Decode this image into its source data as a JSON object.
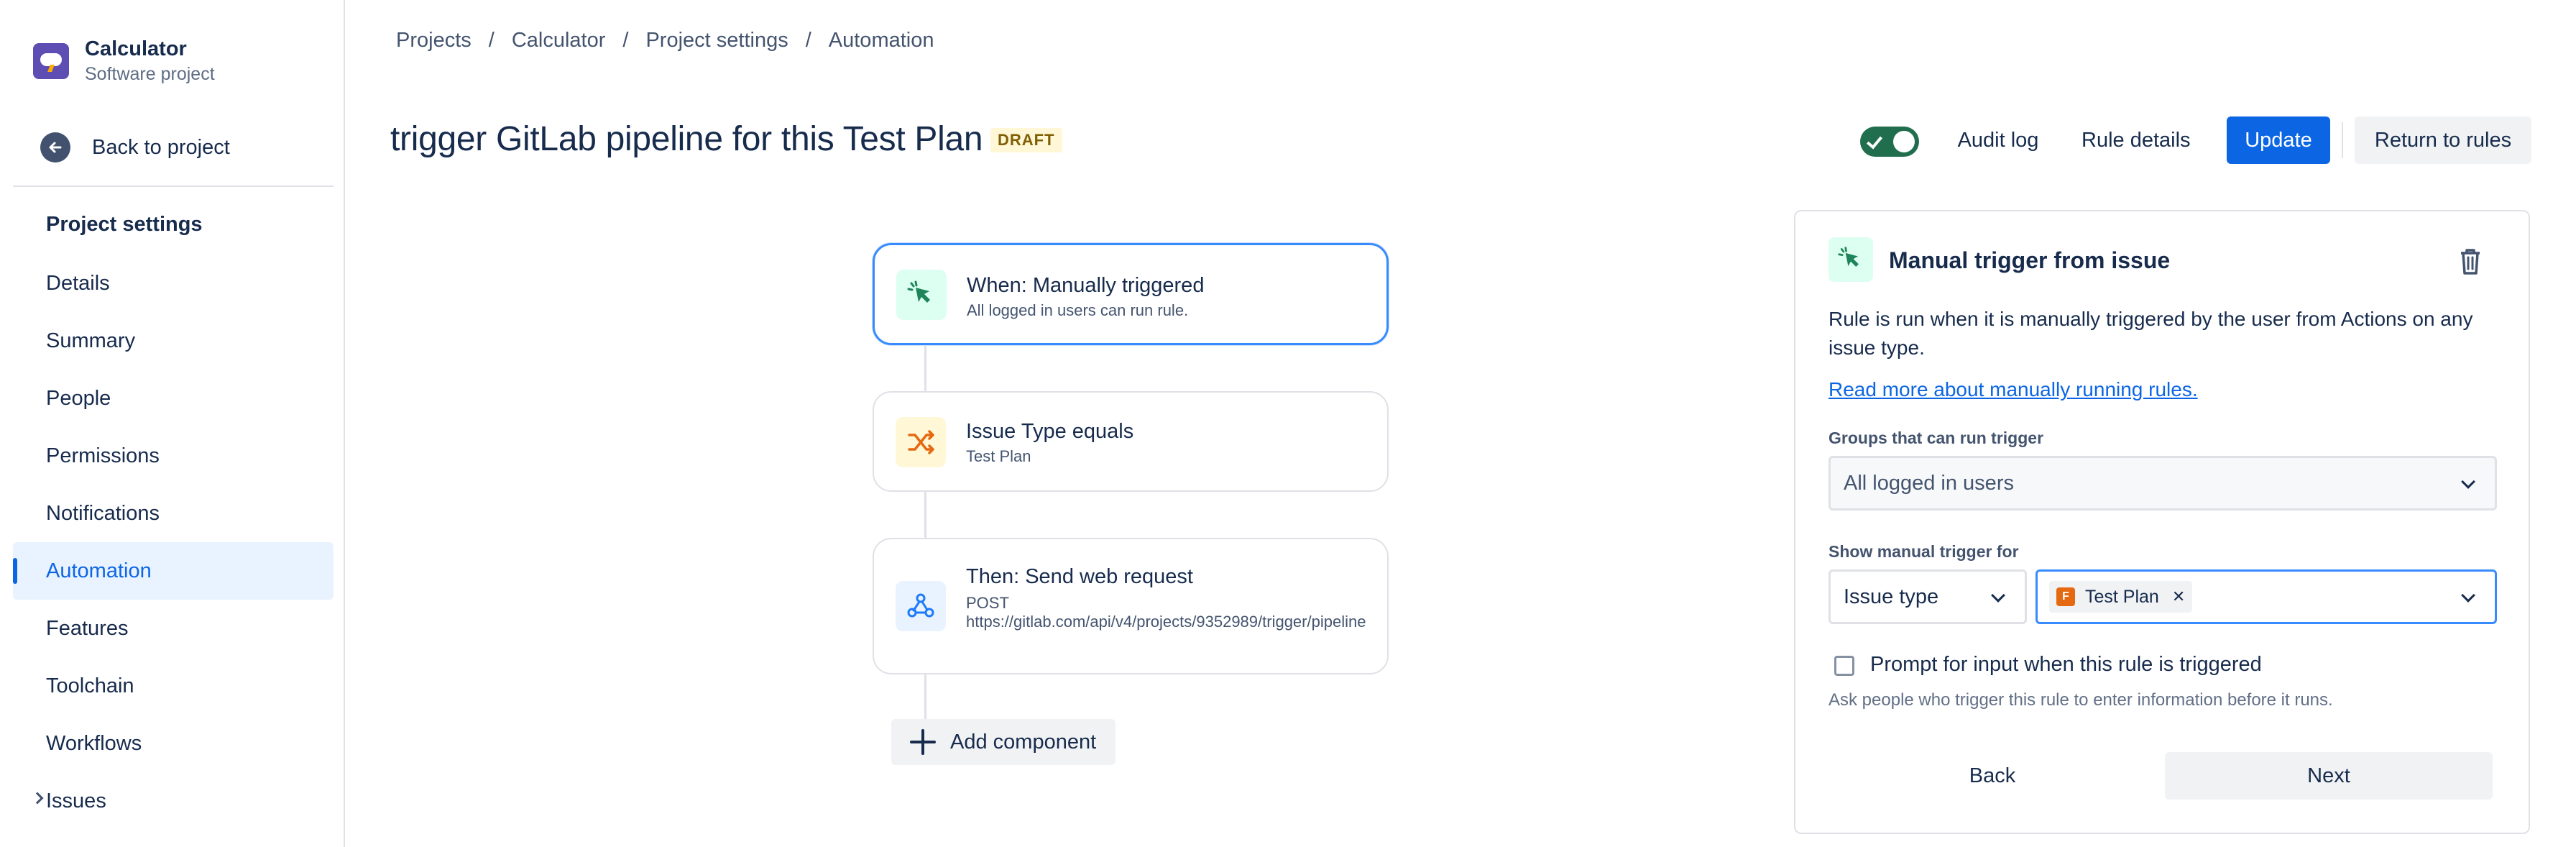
{
  "project": {
    "name": "Calculator",
    "type": "Software project"
  },
  "sidebar": {
    "back_label": "Back to project",
    "heading": "Project settings",
    "items": [
      {
        "label": "Details"
      },
      {
        "label": "Summary"
      },
      {
        "label": "People"
      },
      {
        "label": "Permissions"
      },
      {
        "label": "Notifications"
      },
      {
        "label": "Automation",
        "active": true
      },
      {
        "label": "Features"
      },
      {
        "label": "Toolchain"
      },
      {
        "label": "Workflows"
      },
      {
        "label": "Issues"
      }
    ]
  },
  "breadcrumb": [
    "Projects",
    "Calculator",
    "Project settings",
    "Automation"
  ],
  "breadcrumb_sep": "/",
  "header": {
    "title": "trigger GitLab pipeline for this Test Plan",
    "status": "DRAFT",
    "toggle_enabled": true,
    "audit_log": "Audit log",
    "rule_details": "Rule details",
    "update": "Update",
    "return": "Return to rules"
  },
  "flow": {
    "trigger": {
      "title": "When: Manually triggered",
      "subtitle": "All logged in users can run rule.",
      "icon": "cursor-click-icon"
    },
    "condition": {
      "title": "Issue Type equals",
      "subtitle": "Test Plan",
      "icon": "shuffle-icon"
    },
    "action": {
      "title": "Then: Send web request",
      "method": "POST",
      "url": "https://gitlab.com/api/v4/projects/9352989/trigger/pipeline",
      "icon": "webhook-icon"
    },
    "add_component": "Add component"
  },
  "panel": {
    "title": "Manual trigger from issue",
    "description": "Rule is run when it is manually triggered by the user from Actions on any issue type.",
    "link": "Read more about manually running rules.",
    "groups_label": "Groups that can run trigger",
    "groups_value": "All logged in users",
    "show_for_label": "Show manual trigger for",
    "show_for_type": "Issue type",
    "show_for_tag": "Test Plan",
    "checkbox_label": "Prompt for input when this rule is triggered",
    "checkbox_checked": false,
    "checkbox_help": "Ask people who trigger this rule to enter information before it runs.",
    "back": "Back",
    "next": "Next"
  },
  "colors": {
    "primary": "#0c66e4",
    "toggle_on": "#216e4e",
    "selected_border": "#388bff"
  }
}
